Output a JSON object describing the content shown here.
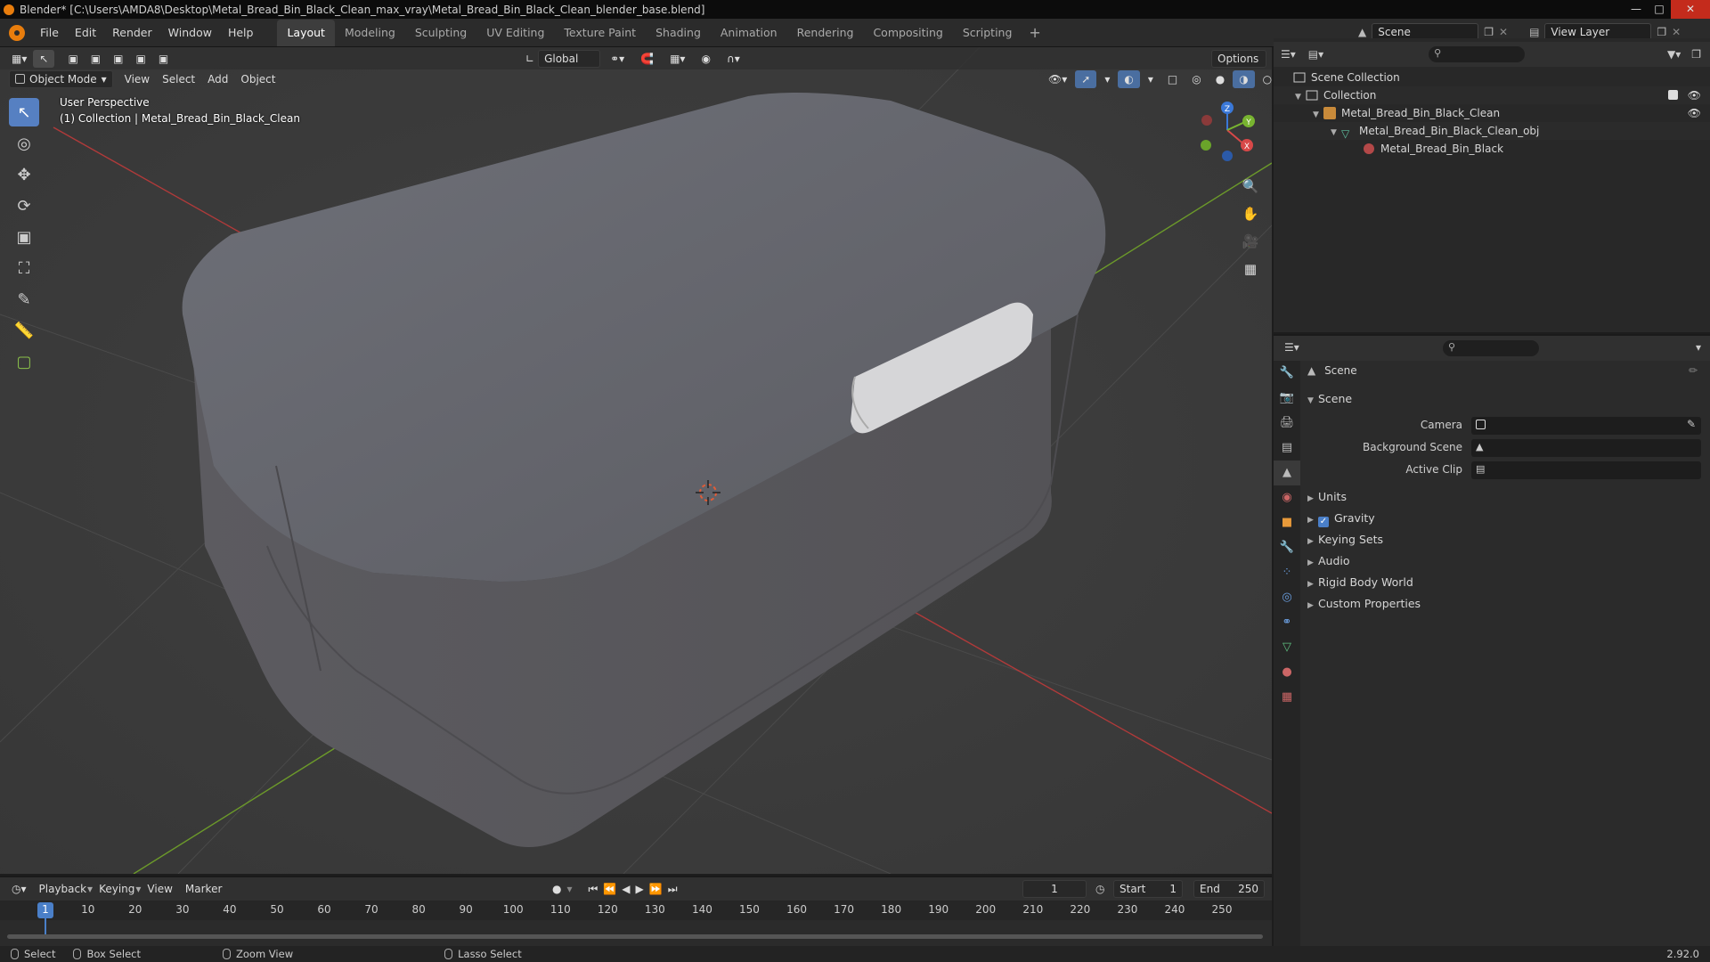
{
  "window": {
    "title": "Blender* [C:\\Users\\AMDA8\\Desktop\\Metal_Bread_Bin_Black_Clean_max_vray\\Metal_Bread_Bin_Black_Clean_blender_base.blend]"
  },
  "menubar": {
    "items": [
      "File",
      "Edit",
      "Render",
      "Window",
      "Help"
    ]
  },
  "workspaces": {
    "tabs": [
      "Layout",
      "Modeling",
      "Sculpting",
      "UV Editing",
      "Texture Paint",
      "Shading",
      "Animation",
      "Rendering",
      "Compositing",
      "Scripting"
    ],
    "active": "Layout"
  },
  "scene_selector": {
    "scene": "Scene",
    "view_layer": "View Layer"
  },
  "viewport": {
    "orientation": "Global",
    "options_label": "Options",
    "mode": "Object Mode",
    "menus": [
      "View",
      "Select",
      "Add",
      "Object"
    ],
    "overlay_title": "User Perspective",
    "overlay_subtitle": "(1) Collection | Metal_Bread_Bin_Black_Clean",
    "gizmo": {
      "x": "X",
      "y": "Y",
      "z": "Z"
    },
    "object_color": "#6b6b72",
    "handle_color": "#d6d6d8"
  },
  "outliner": {
    "rows": [
      {
        "label": "Scene Collection"
      },
      {
        "label": "Collection"
      },
      {
        "label": "Metal_Bread_Bin_Black_Clean"
      },
      {
        "label": "Metal_Bread_Bin_Black_Clean_obj"
      },
      {
        "label": "Metal_Bread_Bin_Black"
      }
    ]
  },
  "properties": {
    "context": "Scene",
    "section": "Scene",
    "fields": [
      {
        "label": "Camera"
      },
      {
        "label": "Background Scene"
      },
      {
        "label": "Active Clip"
      }
    ],
    "panels": [
      "Units",
      "Gravity",
      "Keying Sets",
      "Audio",
      "Rigid Body World",
      "Custom Properties"
    ]
  },
  "timeline": {
    "menus": [
      "Playback",
      "Keying",
      "View",
      "Marker"
    ],
    "current_frame": "1",
    "start_label": "Start",
    "start": "1",
    "end_label": "End",
    "end": "250",
    "ticks": [
      "1",
      "10",
      "20",
      "30",
      "40",
      "50",
      "60",
      "70",
      "80",
      "90",
      "100",
      "110",
      "120",
      "130",
      "140",
      "150",
      "160",
      "170",
      "180",
      "190",
      "200",
      "210",
      "220",
      "230",
      "240",
      "250"
    ]
  },
  "statusbar": {
    "select": "Select",
    "box_select": "Box Select",
    "zoom_view": "Zoom View",
    "lasso_select": "Lasso Select",
    "version": "2.92.0"
  }
}
